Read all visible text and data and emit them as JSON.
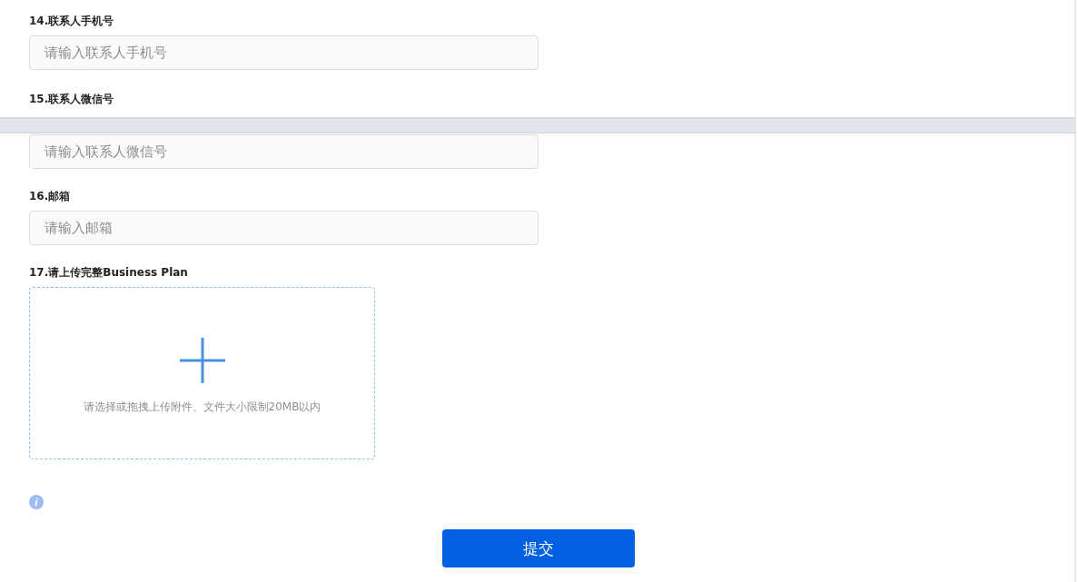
{
  "fields": [
    {
      "label": "14.联系人手机号",
      "placeholder": "请输入联系人手机号"
    },
    {
      "label": "15.联系人微信号",
      "placeholder": "请输入联系人微信号"
    },
    {
      "label": "16.邮箱",
      "placeholder": "请输入邮箱"
    }
  ],
  "upload": {
    "label": "17.请上传完整Business Plan",
    "hint": "请选择或拖拽上传附件、文件大小限制20MB以内"
  },
  "submit": "提交"
}
